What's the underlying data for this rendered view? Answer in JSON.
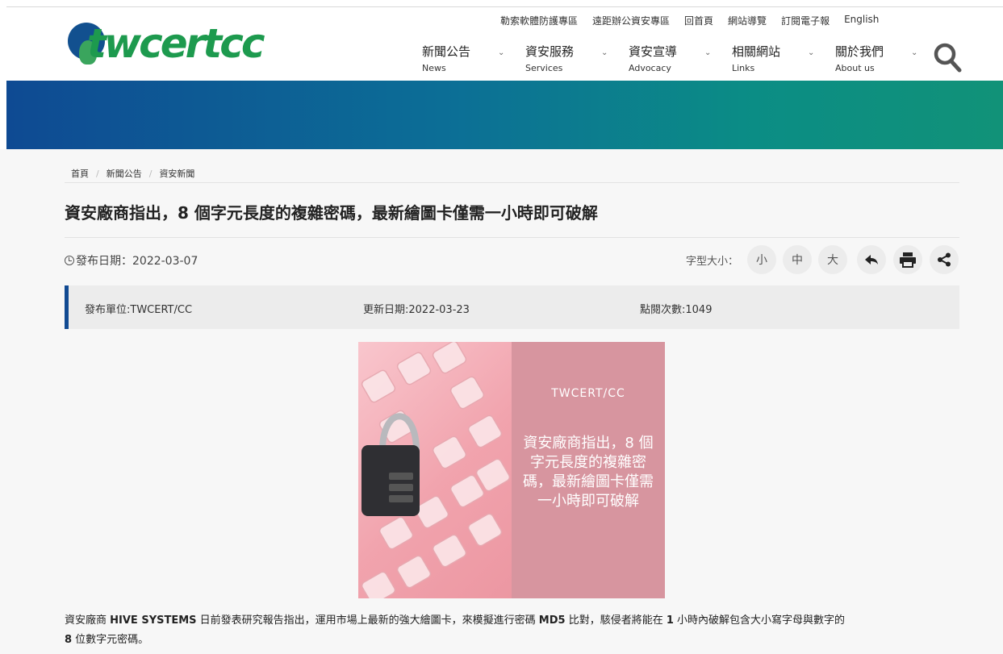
{
  "header": {
    "logo_text": "twcertcc",
    "util_links": [
      "勒索軟體防護專區",
      "遠距辦公資安專區",
      "回首頁",
      "網站導覽",
      "訂閱電子報",
      "English"
    ],
    "nav": [
      {
        "zh": "新聞公告",
        "en": "News"
      },
      {
        "zh": "資安服務",
        "en": "Services"
      },
      {
        "zh": "資安宣導",
        "en": "Advocacy"
      },
      {
        "zh": "相關網站",
        "en": "Links"
      },
      {
        "zh": "關於我們",
        "en": "About us"
      }
    ]
  },
  "breadcrumb": [
    "首頁",
    "新聞公告",
    "資安新聞"
  ],
  "article": {
    "title": "資安廠商指出，8 個字元長度的複雜密碼，最新繪圖卡僅需一小時即可破解",
    "pub_date": "發布日期：2022-03-07",
    "font_size_label": "字型大小：",
    "font_sizes": [
      "小",
      "中",
      "大"
    ],
    "publisher": "發布單位:TWCERT/CC",
    "updated": "更新日期:2022-03-23",
    "views": "點閱次數:1049",
    "image_brand": "TWCERT/CC",
    "image_caption": "資安廠商指出，8 個字元長度的複雜密碼，最新繪圖卡僅需一小時即可破解",
    "body_parts": [
      "資安廠商 ",
      "HIVE SYSTEMS",
      " 日前發表研究報告指出，運用市場上最新的強大繪圖卡，來模擬進行密碼 ",
      "MD5",
      " 比對，駭侵者將能在 ",
      "1",
      " 小時內破解包含大小寫字母與數字的",
      "8",
      " 位數字元密碼。"
    ]
  },
  "colors": {
    "banner_start": "#0e4a93",
    "banner_end": "#119278",
    "logo_green": "#1d9a4e",
    "accent_blue": "#114a92"
  },
  "icons": [
    "search-icon",
    "clock-icon",
    "back-icon",
    "print-icon",
    "share-icon",
    "chevron-down-icon"
  ]
}
